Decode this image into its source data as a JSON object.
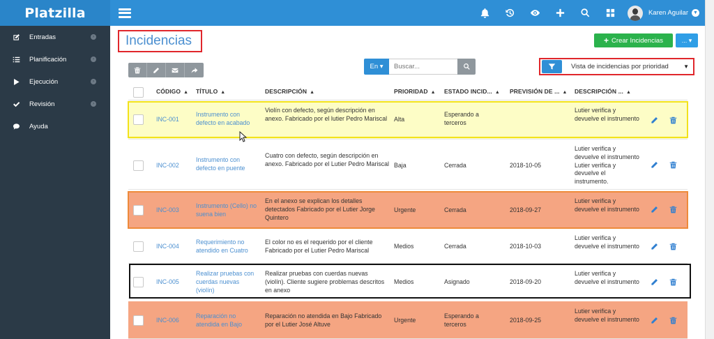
{
  "app": {
    "brand": "Platzilla"
  },
  "header": {
    "user_name": "Karen Aguilar",
    "icons": [
      "bell-icon",
      "history-icon",
      "eye-icon",
      "plus-icon",
      "search-icon",
      "grid-icon"
    ]
  },
  "sidebar": {
    "items": [
      {
        "label": "Entradas",
        "icon": "edit-icon",
        "has_arrow": true
      },
      {
        "label": "Planificación",
        "icon": "list-icon",
        "has_arrow": true
      },
      {
        "label": "Ejecución",
        "icon": "play-icon",
        "has_arrow": true
      },
      {
        "label": "Revisión",
        "icon": "check-icon",
        "has_arrow": true
      },
      {
        "label": "Ayuda",
        "icon": "chat-icon",
        "has_arrow": false
      }
    ]
  },
  "page": {
    "title": "Incidencias",
    "create_button": "Crear Incidencias",
    "more_button": "... ▾"
  },
  "search": {
    "scope": "En ▾",
    "placeholder": "Buscar..."
  },
  "filter": {
    "selected_view": "Vista de incidencias por prioridad"
  },
  "table": {
    "columns": [
      "CÓDIGO",
      "TÍTULO",
      "DESCRIPCIÓN",
      "PRIORIDAD",
      "ESTADO INCID...",
      "PREVISIÓN DE ...",
      "DESCRIPCIÓN ..."
    ],
    "rows": [
      {
        "code": "INC-001",
        "title": "Instrumento con defecto en acabado",
        "description": "Violín con defecto, según descripción en anexo. Fabricado por el lutier Pedro Mariscal",
        "priority": "Alta",
        "status": "Esperando a terceros",
        "forecast": "",
        "resolution": "Lutier verifica y devuelve el instrumento",
        "highlight": "yellow"
      },
      {
        "code": "INC-002",
        "title": "Instrumento con defecto en puente",
        "description": "Cuatro con defecto, según descripción en anexo. Fabricado por el Lutier Pedro Mariscal",
        "priority": "Baja",
        "status": "Cerrada",
        "forecast": "2018-10-05",
        "resolution": "Lutier verifica y devuelve el instrumento Lutier verifica y devuelve el instrumento.",
        "highlight": "none"
      },
      {
        "code": "INC-003",
        "title": "Instrumento (Cello) no suena bien",
        "description": "En el anexo se explican los detalles detectados Fabricado por el Lutier Jorge Quintero",
        "priority": "Urgente",
        "status": "Cerrada",
        "forecast": "2018-09-27",
        "resolution": "Lutier verifica y devuelve el instrumento",
        "highlight": "orange"
      },
      {
        "code": "INC-004",
        "title": "Requerimiento no atendido en Cuatro",
        "description": "El color no es el requerido por el cliente Fabricado por el Lutier Pedro Mariscal",
        "priority": "Medios",
        "status": "Cerrada",
        "forecast": "2018-10-03",
        "resolution": "Lutier verifica y devuelve el instrumento",
        "highlight": "none"
      },
      {
        "code": "INC-005",
        "title": "Realizar pruebas con cuerdas nuevas (violín)",
        "description": "Realizar pruebas con cuerdas nuevas (violín). Cliente sugiere problemas descritos en anexo",
        "priority": "Medios",
        "status": "Asignado",
        "forecast": "2018-09-20",
        "resolution": "Lutier verifica y devuelve el instrumento",
        "highlight": "black-frame"
      },
      {
        "code": "INC-006",
        "title": "Reparación no atendida en Bajo",
        "description": "Reparación no atendida en Bajo Fabricado por el Lutier José Altuve",
        "priority": "Urgente",
        "status": "Esperando a terceros",
        "forecast": "2018-09-25",
        "resolution": "Lutier verifica y devuelve el instrumento",
        "highlight": "orange"
      }
    ]
  },
  "colors": {
    "topbar": "#2f8fd6",
    "sidebar": "#2b3a47",
    "accent_green": "#2bb24c",
    "row_yellow": "#fdfdc6",
    "row_orange": "#f5a582",
    "frame_red": "#e0262b",
    "frame_yellow": "#f2e21b",
    "frame_orange": "#ee8a3a",
    "frame_black": "#111111"
  }
}
